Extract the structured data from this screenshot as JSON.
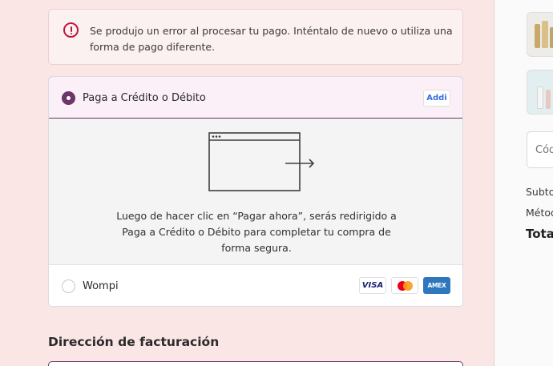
{
  "error_banner": {
    "message": "Se produjo un error al procesar tu pago. Inténtalo de nuevo o utiliza una forma de pago diferente."
  },
  "payment_methods": {
    "addi": {
      "label": "Paga a Crédito o Débito",
      "badge": "Addi",
      "selected": true,
      "redirect_text": "Luego de hacer clic en “Pagar ahora”, serás redirigido a Paga a Crédito o Débito para completar tu compra de forma segura."
    },
    "wompi": {
      "label": "Wompi",
      "selected": false,
      "cards": [
        {
          "name": "visa-icon",
          "label": "VISA"
        },
        {
          "name": "mastercard-icon",
          "label": ""
        },
        {
          "name": "amex-icon",
          "label": "AMEX"
        }
      ]
    }
  },
  "billing": {
    "heading": "Dirección de facturación"
  },
  "order_summary": {
    "discount_placeholder": "Cód",
    "subtotal_label": "Subto",
    "shipping_label": "Métod",
    "total_label": "Total"
  },
  "colors": {
    "accent": "#6b3668",
    "error": "#c0143c",
    "page_background": "#fbe6e6"
  }
}
